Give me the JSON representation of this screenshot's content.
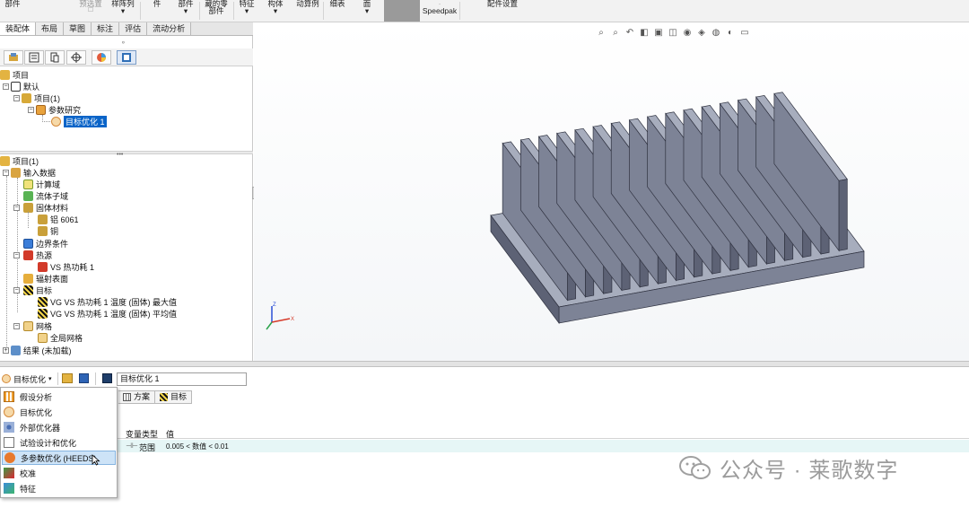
{
  "ribbon": {
    "buttons": [
      {
        "label": "部件",
        "name": "rib-part-1"
      },
      {
        "label": "",
        "name": "rib-part-2"
      },
      {
        "label": "预选置",
        "name": "rib-presel"
      },
      {
        "label": "样阵列",
        "name": "rib-pattern"
      },
      {
        "label": "件",
        "name": "rib-part-3"
      },
      {
        "label": "部件",
        "name": "rib-part-4"
      },
      {
        "label": "藏的零部件",
        "name": "rib-hidden-parts"
      },
      {
        "label": "特征",
        "name": "rib-feature"
      },
      {
        "label": "构体",
        "name": "rib-structure"
      },
      {
        "label": "动算例",
        "name": "rib-motion-study"
      },
      {
        "label": "细表",
        "name": "rib-bom"
      },
      {
        "label": "面",
        "name": "rib-face"
      },
      {
        "label": "Speedpak",
        "name": "rib-speedpak"
      },
      {
        "label": "配件设置",
        "name": "rib-accessory-settings"
      }
    ]
  },
  "tabs": [
    "装配体",
    "布局",
    "草图",
    "标注",
    "评估",
    "流动分析"
  ],
  "upper_tree": {
    "root": "项目",
    "default": "默认",
    "project": "项目(1)",
    "param_study": "参数研究",
    "target_opt": "目标优化 1"
  },
  "lower_tree": {
    "project": "项目(1)",
    "input_data": "输入数据",
    "comp_domain": "计算域",
    "fluid_subdomain": "流体子域",
    "solid_materials": "固体材料",
    "mat_aluminum": "铝 6061",
    "mat_copper": "铜",
    "boundary": "边界条件",
    "heat_source": "热源",
    "heat_source_item": "VS 热功耗 1",
    "radiation": "辐射表面",
    "goals": "目标",
    "goal_max": "VG VS 热功耗 1 温度 (固体) 最大值",
    "goal_avg": "VG VS 热功耗 1 温度 (固体) 平均值",
    "mesh": "网格",
    "global_mesh": "全局网格",
    "results": "结果 (未加载)"
  },
  "bottom": {
    "mode_combo": "目标优化",
    "name_input": "目标优化 1",
    "tab_scheme": "方案",
    "tab_goal": "目标",
    "col_var_type": "变量类型",
    "col_value": "值",
    "row_type": "范围",
    "row_value": "0.005 < 数值 < 0.01"
  },
  "dropdown": {
    "items": [
      {
        "label": "假设分析",
        "name": "dd-what-if"
      },
      {
        "label": "目标优化",
        "name": "dd-goal-opt"
      },
      {
        "label": "外部优化器",
        "name": "dd-external-opt"
      },
      {
        "label": "试验设计和优化",
        "name": "dd-doe-opt"
      },
      {
        "label": "多参数优化 (HEEDS)",
        "name": "dd-heeds"
      },
      {
        "label": "校准",
        "name": "dd-calibration"
      },
      {
        "label": "特征",
        "name": "dd-feature"
      }
    ]
  },
  "watermark": {
    "text": "公众号 · 莱歌数字"
  },
  "colors": {
    "metal_front": "#7d8396",
    "metal_side": "#5d6275",
    "metal_top": "#a7adbd",
    "highlight": "#0a64c8"
  }
}
